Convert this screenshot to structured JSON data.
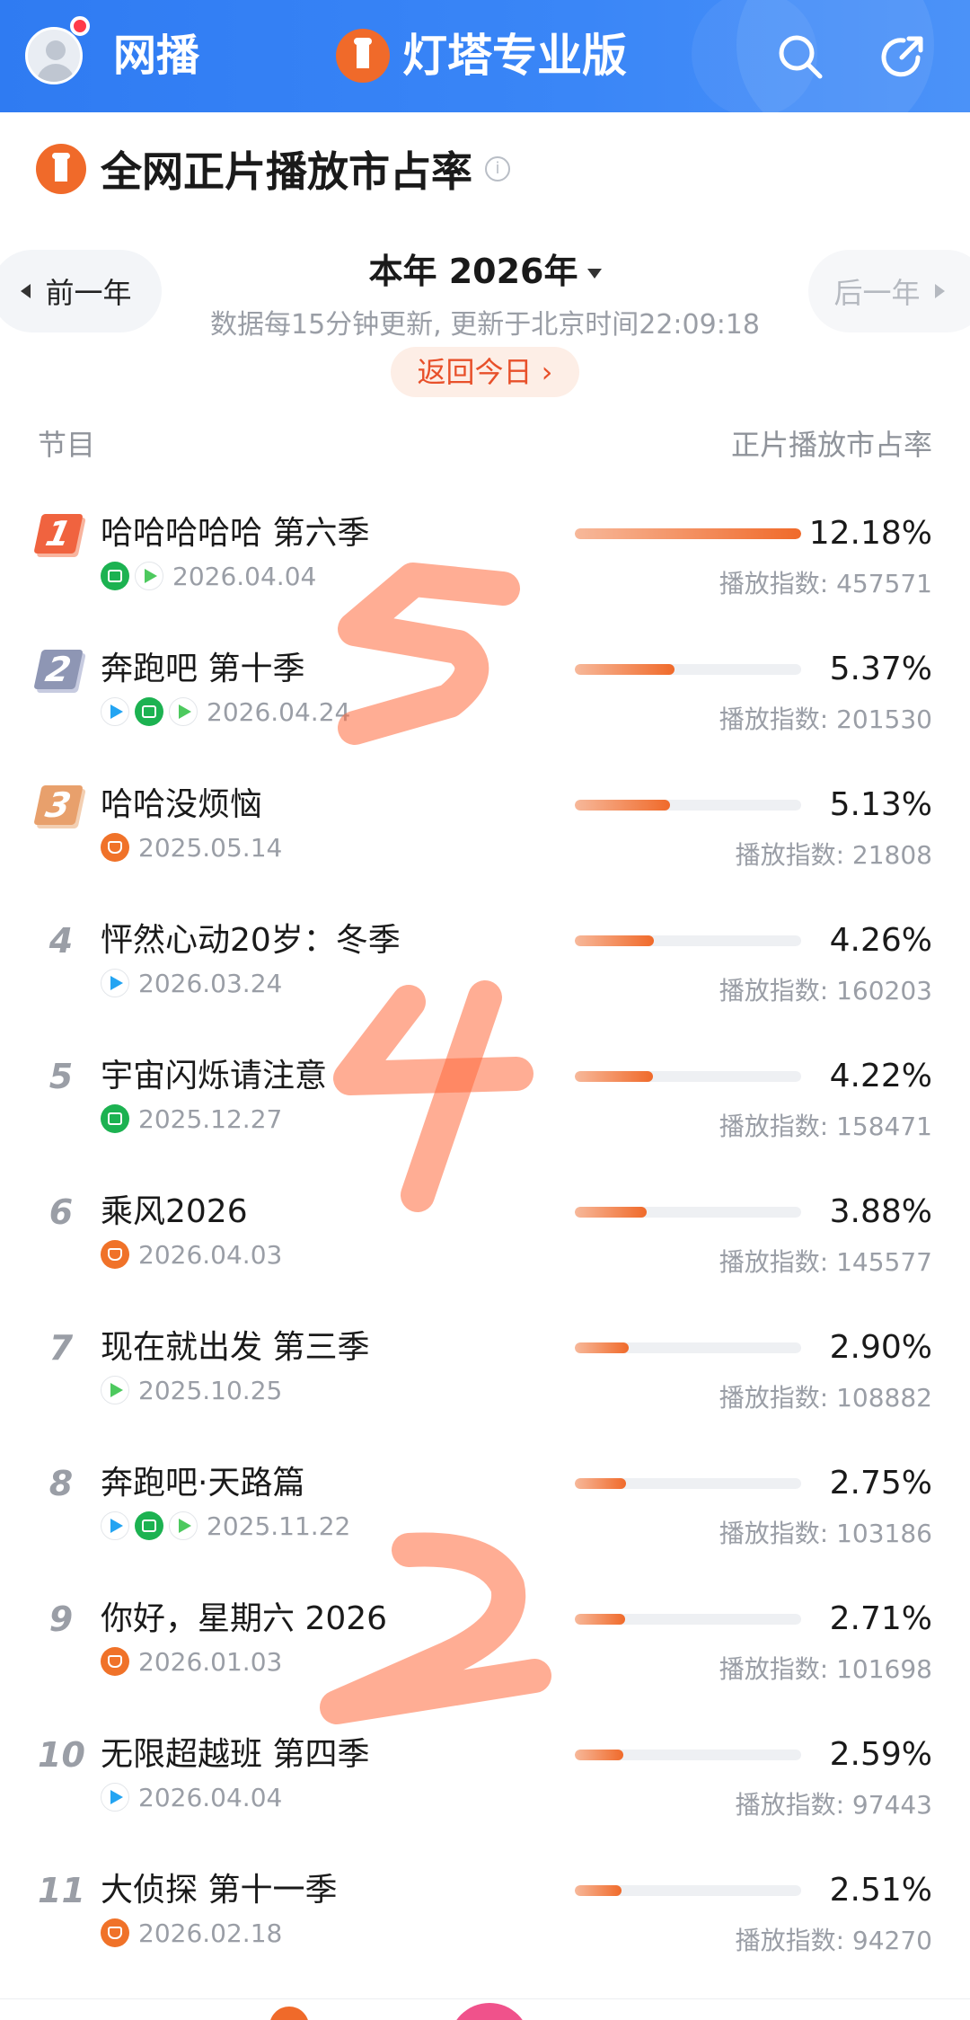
{
  "header": {
    "left_label": "网播",
    "brand_title": "灯塔专业版"
  },
  "page_title": "全网正片播放市占率",
  "year_nav": {
    "prev_label": "前一年",
    "next_label": "后一年",
    "current": "本年 2026年",
    "update_note": "数据每15分钟更新, 更新于北京时间22:09:18",
    "back_today": "返回今日 ›"
  },
  "columns": {
    "program": "节目",
    "share": "正片播放市占率"
  },
  "index_prefix": "播放指数: ",
  "rows": [
    {
      "rank": "1",
      "name": "哈哈哈哈哈 第六季",
      "platforms": [
        "iqiyi",
        "youku"
      ],
      "date": "2026.04.04",
      "share": "12.18%",
      "share_value": 12.18,
      "index": "播放指数: 457571"
    },
    {
      "rank": "2",
      "name": "奔跑吧 第十季",
      "platforms": [
        "tencent",
        "iqiyi",
        "youku"
      ],
      "date": "2026.04.24",
      "share": "5.37%",
      "share_value": 5.37,
      "index": "播放指数: 201530"
    },
    {
      "rank": "3",
      "name": "哈哈没烦恼",
      "platforms": [
        "mango"
      ],
      "date": "2025.05.14",
      "share": "5.13%",
      "share_value": 5.13,
      "index": "播放指数: 21808"
    },
    {
      "rank": "4",
      "name": "怦然心动20岁：冬季",
      "platforms": [
        "tencent"
      ],
      "date": "2026.03.24",
      "share": "4.26%",
      "share_value": 4.26,
      "index": "播放指数: 160203"
    },
    {
      "rank": "5",
      "name": "宇宙闪烁请注意",
      "platforms": [
        "iqiyi"
      ],
      "date": "2025.12.27",
      "share": "4.22%",
      "share_value": 4.22,
      "index": "播放指数: 158471"
    },
    {
      "rank": "6",
      "name": "乘风2026",
      "platforms": [
        "mango"
      ],
      "date": "2026.04.03",
      "share": "3.88%",
      "share_value": 3.88,
      "index": "播放指数: 145577"
    },
    {
      "rank": "7",
      "name": "现在就出发 第三季",
      "platforms": [
        "youku"
      ],
      "date": "2025.10.25",
      "share": "2.90%",
      "share_value": 2.9,
      "index": "播放指数: 108882"
    },
    {
      "rank": "8",
      "name": "奔跑吧·天路篇",
      "platforms": [
        "tencent",
        "iqiyi",
        "youku"
      ],
      "date": "2025.11.22",
      "share": "2.75%",
      "share_value": 2.75,
      "index": "播放指数: 103186"
    },
    {
      "rank": "9",
      "name": "你好，星期六 2026",
      "platforms": [
        "mango"
      ],
      "date": "2026.01.03",
      "share": "2.71%",
      "share_value": 2.71,
      "index": "播放指数: 101698"
    },
    {
      "rank": "10",
      "name": "无限超越班 第四季",
      "platforms": [
        "tencent"
      ],
      "date": "2026.04.04",
      "share": "2.59%",
      "share_value": 2.59,
      "index": "播放指数: 97443"
    },
    {
      "rank": "11",
      "name": "大侦探 第十一季",
      "platforms": [
        "mango"
      ],
      "date": "2026.02.18",
      "share": "2.51%",
      "share_value": 2.51,
      "index": "播放指数: 94270"
    }
  ],
  "annotations": [
    "5",
    "4",
    "2"
  ],
  "colors": {
    "header_blue": "#3a86f7",
    "accent_orange": "#f06a2a",
    "annotation_orange": "#ff6a3d"
  }
}
